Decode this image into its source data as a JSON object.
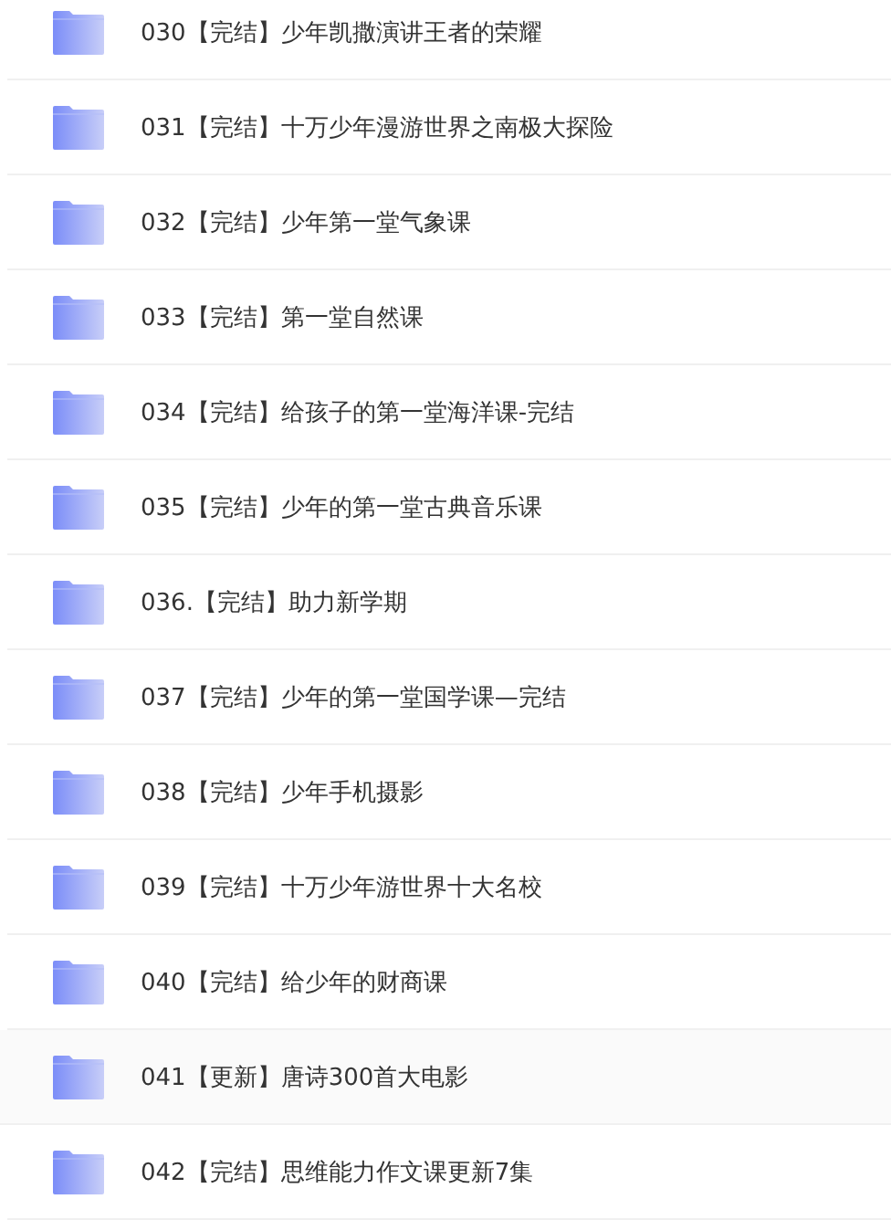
{
  "folders": [
    {
      "name": "030【完结】少年凯撒演讲王者的荣耀",
      "selected": false
    },
    {
      "name": "031【完结】十万少年漫游世界之南极大探险",
      "selected": false
    },
    {
      "name": "032【完结】少年第一堂气象课",
      "selected": false
    },
    {
      "name": "033【完结】第一堂自然课",
      "selected": false
    },
    {
      "name": "034【完结】给孩子的第一堂海洋课-完结",
      "selected": false
    },
    {
      "name": "035【完结】少年的第一堂古典音乐课",
      "selected": false
    },
    {
      "name": "036.【完结】助力新学期",
      "selected": false
    },
    {
      "name": "037【完结】少年的第一堂国学课—完结",
      "selected": false
    },
    {
      "name": "038【完结】少年手机摄影",
      "selected": false
    },
    {
      "name": "039【完结】十万少年游世界十大名校",
      "selected": false
    },
    {
      "name": "040【完结】给少年的财商课",
      "selected": false
    },
    {
      "name": "041【更新】唐诗300首大电影",
      "selected": true
    },
    {
      "name": "042【完结】思维能力作文课更新7集",
      "selected": false
    }
  ]
}
